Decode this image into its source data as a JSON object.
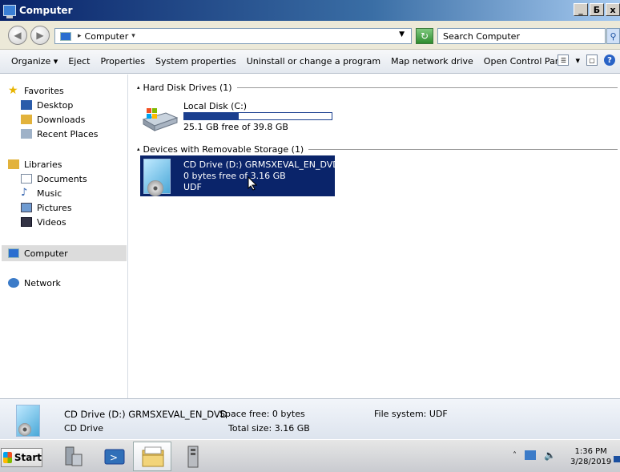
{
  "window": {
    "title": "Computer",
    "min_label": "_",
    "max_label": "Б",
    "close_label": "x"
  },
  "address": {
    "sep": "▸",
    "location": "Computer",
    "caret": "▾",
    "search_placeholder": "Search Computer"
  },
  "toolbar": {
    "organize": "Organize ▾",
    "eject": "Eject",
    "properties": "Properties",
    "system_properties": "System properties",
    "uninstall": "Uninstall or change a program",
    "map_drive": "Map network drive",
    "control_panel": "Open Control Panel",
    "view_caret": "▾",
    "help": "?"
  },
  "nav": {
    "favorites": "Favorites",
    "desktop": "Desktop",
    "downloads": "Downloads",
    "recent": "Recent Places",
    "libraries": "Libraries",
    "documents": "Documents",
    "music": "Music",
    "pictures": "Pictures",
    "videos": "Videos",
    "computer": "Computer",
    "network": "Network"
  },
  "groups": {
    "hdd_header": "Hard Disk Drives (1)",
    "removable_header": "Devices with Removable Storage (1)",
    "caret": "▴"
  },
  "drives": {
    "c_name": "Local Disk (C:)",
    "c_free": "25.1 GB free of 39.8 GB",
    "c_used_fraction": 0.37,
    "d_name": "CD Drive (D:) GRMSXEVAL_EN_DVD",
    "d_free": "0 bytes free of 3.16 GB",
    "d_fs": "UDF"
  },
  "details": {
    "name": "CD Drive (D:) GRMSXEVAL_EN_DVD",
    "type": "CD Drive",
    "space_free_label": "Space free:",
    "space_free": "0 bytes",
    "total_size_label": "Total size:",
    "total_size": "3.16 GB",
    "fs_label": "File system:",
    "fs": "UDF"
  },
  "taskbar": {
    "start": "Start",
    "tray_caret": "˄",
    "time": "1:36 PM",
    "date": "3/28/2019"
  },
  "colors": {
    "selection": "#0a246a",
    "capacity": "#1b3f8f"
  }
}
